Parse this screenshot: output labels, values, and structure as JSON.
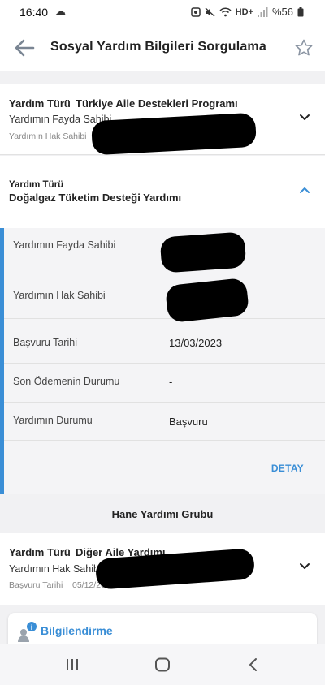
{
  "status_bar": {
    "time": "16:40",
    "weather_glyph": "☁",
    "network_label": "HD+",
    "battery": "%56"
  },
  "header": {
    "title": "Sosyal Yardım Bilgileri Sorgulama"
  },
  "aid_items": [
    {
      "type_label": "Yardım Türü",
      "type_value": "Türkiye Aile Destekleri Programı",
      "beneficiary_label": "Yardımın Fayda Sahibi",
      "right_holder_label": "Yardımın Hak Sahibi"
    },
    {
      "type_label": "Yardım Türü",
      "type_value": "Doğalgaz Tüketim Desteği Yardımı"
    }
  ],
  "details": {
    "rows": [
      {
        "label": "Yardımın Fayda Sahibi",
        "value": ""
      },
      {
        "label": "Yardımın Hak Sahibi",
        "value": ""
      },
      {
        "label": "Başvuru Tarihi",
        "value": "13/03/2023"
      },
      {
        "label": "Son Ödemenin Durumu",
        "value": "-"
      },
      {
        "label": "Yardımın Durumu",
        "value": "Başvuru"
      }
    ],
    "detay_label": "DETAY"
  },
  "household_group": {
    "title": "Hane Yardımı Grubu",
    "item": {
      "type_label": "Yardım Türü",
      "type_value": "Diğer Aile Yardımı",
      "right_holder_label": "Yardımın Hak Sahibi",
      "application_date_label": "Başvuru Tarihi",
      "application_date_value": "05/12/2021"
    }
  },
  "info_card": {
    "title": "Bilgilendirme",
    "badge": "i"
  },
  "colors": {
    "accent": "#3a8ed6"
  }
}
